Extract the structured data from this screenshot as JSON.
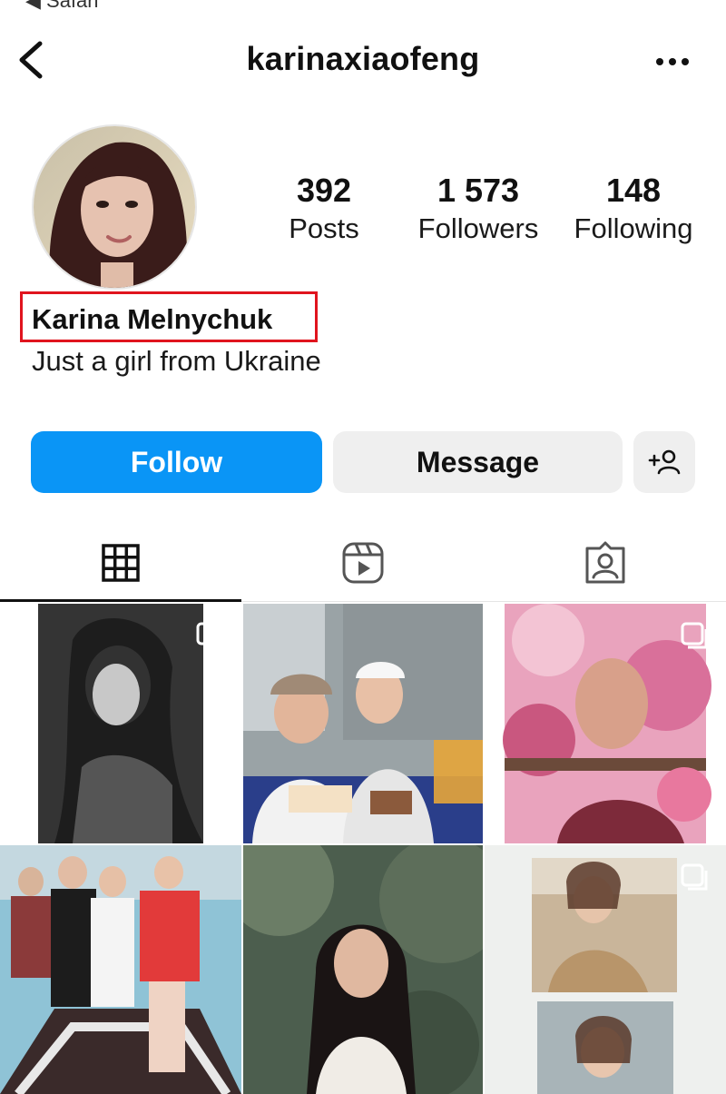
{
  "status_bar": {
    "back_label": "◀ Safari"
  },
  "header": {
    "username": "karinaxiaofeng"
  },
  "stats": [
    {
      "number": "392",
      "label": "Posts"
    },
    {
      "number": "1 573",
      "label": "Followers"
    },
    {
      "number": "148",
      "label": "Following"
    }
  ],
  "profile": {
    "name": "Karina Melnychuk",
    "bio": "Just a girl from Ukraine"
  },
  "actions": {
    "follow_label": "Follow",
    "message_label": "Message"
  },
  "tabs": [
    {
      "icon": "grid-icon",
      "active": true
    },
    {
      "icon": "reels-icon",
      "active": false
    },
    {
      "icon": "tagged-icon",
      "active": false
    }
  ],
  "posts": [
    {
      "icon": "multiple-posts-icon"
    },
    {
      "icon": ""
    },
    {
      "icon": "multiple-posts-icon"
    },
    {
      "icon": ""
    },
    {
      "icon": ""
    },
    {
      "icon": "multiple-posts-icon"
    }
  ],
  "colors": {
    "accent": "#0a95f6",
    "highlight_box": "#e0141e",
    "button_gray": "#efefef"
  }
}
